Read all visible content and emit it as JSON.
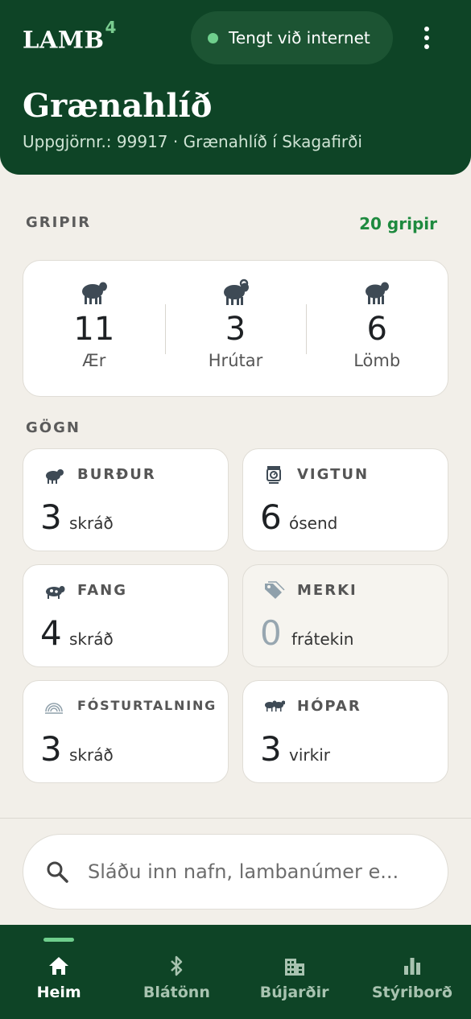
{
  "header": {
    "logo": "LAMB",
    "logo_sup": "4",
    "status": "Tengt við internet",
    "farm_name": "Grænahlíð",
    "farm_sub": "Uppgjörnr.: 99917 · Grænahlíð í Skagafirði"
  },
  "gripir": {
    "label": "GRIPIR",
    "count": "20 gripir",
    "items": [
      {
        "value": "11",
        "label": "Ær",
        "icon": "ewe-icon"
      },
      {
        "value": "3",
        "label": "Hrútar",
        "icon": "ram-icon"
      },
      {
        "value": "6",
        "label": "Lömb",
        "icon": "lamb-icon"
      }
    ]
  },
  "gogn": {
    "label": "GÖGN",
    "tiles": [
      {
        "title": "BURÐUR",
        "value": "3",
        "unit": "skráð",
        "icon": "lambing-icon"
      },
      {
        "title": "VIGTUN",
        "value": "6",
        "unit": "ósend",
        "icon": "scale-icon"
      },
      {
        "title": "FANG",
        "value": "4",
        "unit": "skráð",
        "icon": "mating-icon"
      },
      {
        "title": "MERKI",
        "value": "0",
        "unit": "frátekin",
        "icon": "tag-icon"
      },
      {
        "title": "FÓSTURTALNING",
        "value": "3",
        "unit": "skráð",
        "icon": "ultrasound-icon"
      },
      {
        "title": "HÓPAR",
        "value": "3",
        "unit": "virkir",
        "icon": "groups-icon"
      }
    ]
  },
  "search": {
    "placeholder": "Sláðu inn nafn, lambanúmer e..."
  },
  "nav": [
    {
      "label": "Heim",
      "icon": "home-icon",
      "active": true
    },
    {
      "label": "Blátönn",
      "icon": "bluetooth-icon"
    },
    {
      "label": "Bújarðir",
      "icon": "farm-building-icon"
    },
    {
      "label": "Stýriborð",
      "icon": "dashboard-chart-icon"
    }
  ],
  "colors": {
    "header_green": "#0e4426",
    "accent_green": "#1e8a3f",
    "status_dot": "#6fcf8d",
    "background": "#f2efe9"
  }
}
